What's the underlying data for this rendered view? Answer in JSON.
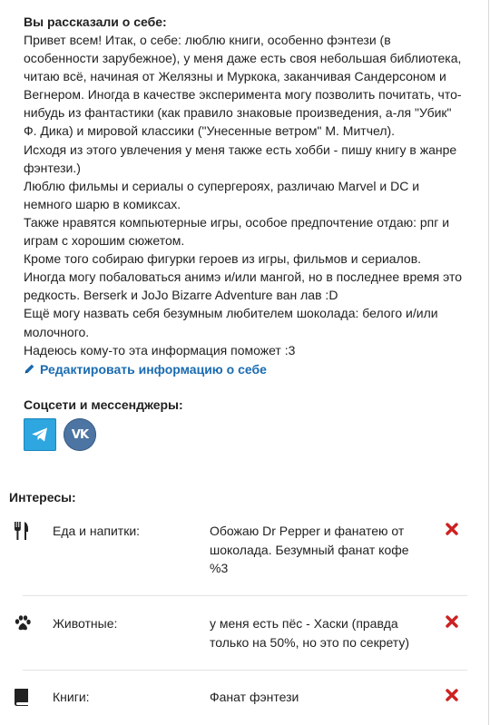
{
  "about": {
    "heading": "Вы рассказали о себе:",
    "paragraphs": [
      "Привет всем! Итак, о себе: люблю книги, особенно фэнтези (в\nособенности зарубежное), у меня даже есть своя небольшая библиотека,\nчитаю всё, начиная от Желязны и Муркока, заканчивая Сандерсоном и\nВегнером. Иногда в качестве эксперимента могу позволить почитать, что-\nнибудь из фантастики (как правило знаковые произведения, а-ля \"Убик\"\nФ. Дика) и мировой классики (\"Унесенные ветром\" М. Митчел).",
      "Исходя из этого увлечения у меня также есть хобби - пишу книгу в жанре\nфэнтези.)",
      "Люблю фильмы и сериалы о супергероях, различаю Marvel и DC и\nнемного шарю в комиксах.",
      "Также нравятся компьютерные игры, особое предпочтение отдаю: рпг и\nиграм с хорошим сюжетом.",
      "Кроме того собираю фигурки героев из игры, фильмов и сериалов.\nИногда могу побаловаться анимэ и/или мангой, но в последнее время это\nредкость. Berserk и JoJo Bizarre Adventure ван лав :D",
      "Ещё могу назвать себя безумным любителем шоколада: белого и/или\nмолочного.",
      "Надеюсь кому-то эта информация поможет :3"
    ],
    "edit_link": "Редактировать информацию о себе"
  },
  "social": {
    "heading": "Соцсети и мессенджеры:",
    "icons": [
      "telegram-icon",
      "vk-icon"
    ],
    "vk_text": "VK"
  },
  "interests": {
    "heading": "Интересы:",
    "items": [
      {
        "icon": "fork-knife-icon",
        "category": "Еда и напитки:",
        "value": "Обожаю Dr Pepper и фанатею от\nшоколада. Безумный фанат кофе\n%3"
      },
      {
        "icon": "paw-icon",
        "category": "Животные:",
        "value": "у меня есть пёс - Хаски (правда\nтолько на 50%, но это по секрету)"
      },
      {
        "icon": "book-icon",
        "category": "Книги:",
        "value": "Фанат фэнтези"
      }
    ]
  },
  "colors": {
    "link": "#1a6bb0",
    "delete": "#cc2222",
    "telegram": "#2ea6df",
    "vk": "#4c75a3"
  }
}
